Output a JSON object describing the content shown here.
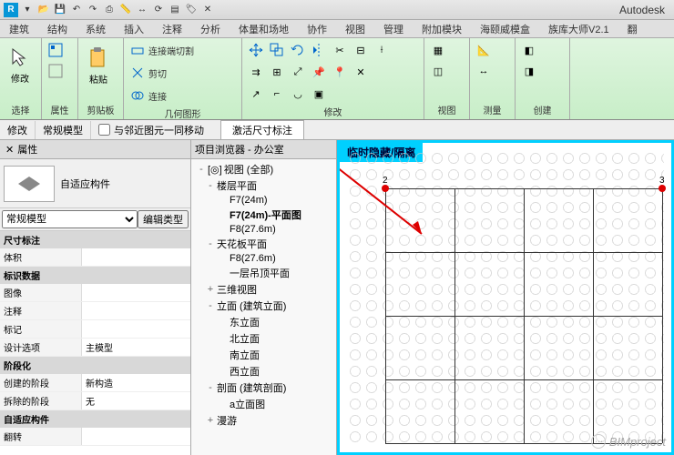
{
  "brand": "Autodesk",
  "qat_icons": [
    "R",
    "new",
    "open",
    "save",
    "undo",
    "redo",
    "print",
    "measure",
    "dim",
    "sync",
    "cloud",
    "tag",
    "del"
  ],
  "ribbon_tabs": [
    "建筑",
    "结构",
    "系统",
    "插入",
    "注释",
    "分析",
    "体量和场地",
    "协作",
    "视图",
    "管理",
    "附加模块",
    "海颐威模盒",
    "族库大师V2.1",
    "翻"
  ],
  "ribbon": {
    "panel1": {
      "big": "修改",
      "label": "选择"
    },
    "panel2": {
      "label": "属性"
    },
    "panel3": {
      "big": "粘贴",
      "label": "剪贴板"
    },
    "panel4": {
      "r1": "连接端切割",
      "r2": "剪切",
      "r3": "连接",
      "label": "几何图形"
    },
    "panel5": {
      "label": "修改"
    },
    "panel6": {
      "label": "视图"
    },
    "panel7": {
      "label": "测量"
    },
    "panel8": {
      "label": "创建"
    }
  },
  "context": {
    "c1": "修改",
    "c2": "常规模型",
    "chk": "与邻近图元一同移动",
    "callout": "激活尺寸标注"
  },
  "props": {
    "title": "属性",
    "type_name": "自适应构件",
    "filter": "常规模型",
    "edit_type": "编辑类型",
    "sections": [
      {
        "name": "尺寸标注",
        "rows": [
          [
            "体积",
            ""
          ]
        ]
      },
      {
        "name": "标识数据",
        "rows": [
          [
            "图像",
            ""
          ],
          [
            "注释",
            ""
          ],
          [
            "标记",
            ""
          ],
          [
            "设计选项",
            "主模型"
          ]
        ]
      },
      {
        "name": "阶段化",
        "rows": [
          [
            "创建的阶段",
            "新构造"
          ],
          [
            "拆除的阶段",
            "无"
          ]
        ]
      },
      {
        "name": "自适应构件",
        "rows": [
          [
            "翻转",
            ""
          ]
        ]
      }
    ]
  },
  "browser": {
    "title": "项目浏览器 - 办公室",
    "root": "视图 (全部)",
    "nodes": [
      {
        "l": 1,
        "t": "楼层平面",
        "exp": "-"
      },
      {
        "l": 2,
        "t": "F7(24m)"
      },
      {
        "l": 2,
        "t": "F7(24m)-平面图",
        "bold": true
      },
      {
        "l": 2,
        "t": "F8(27.6m)"
      },
      {
        "l": 1,
        "t": "天花板平面",
        "exp": "-"
      },
      {
        "l": 2,
        "t": "F8(27.6m)"
      },
      {
        "l": 2,
        "t": "一层吊顶平面"
      },
      {
        "l": 1,
        "t": "三维视图",
        "exp": "+"
      },
      {
        "l": 1,
        "t": "立面 (建筑立面)",
        "exp": "-"
      },
      {
        "l": 2,
        "t": "东立面"
      },
      {
        "l": 2,
        "t": "北立面"
      },
      {
        "l": 2,
        "t": "南立面"
      },
      {
        "l": 2,
        "t": "西立面"
      },
      {
        "l": 1,
        "t": "剖面 (建筑剖面)",
        "exp": "-"
      },
      {
        "l": 2,
        "t": "a立面图"
      },
      {
        "l": 1,
        "t": "漫游",
        "exp": "+"
      }
    ]
  },
  "canvas": {
    "temp_hide": "临时隐藏/隔离",
    "grid_labels": [
      "2",
      "3"
    ],
    "watermark": "BIMproject"
  }
}
